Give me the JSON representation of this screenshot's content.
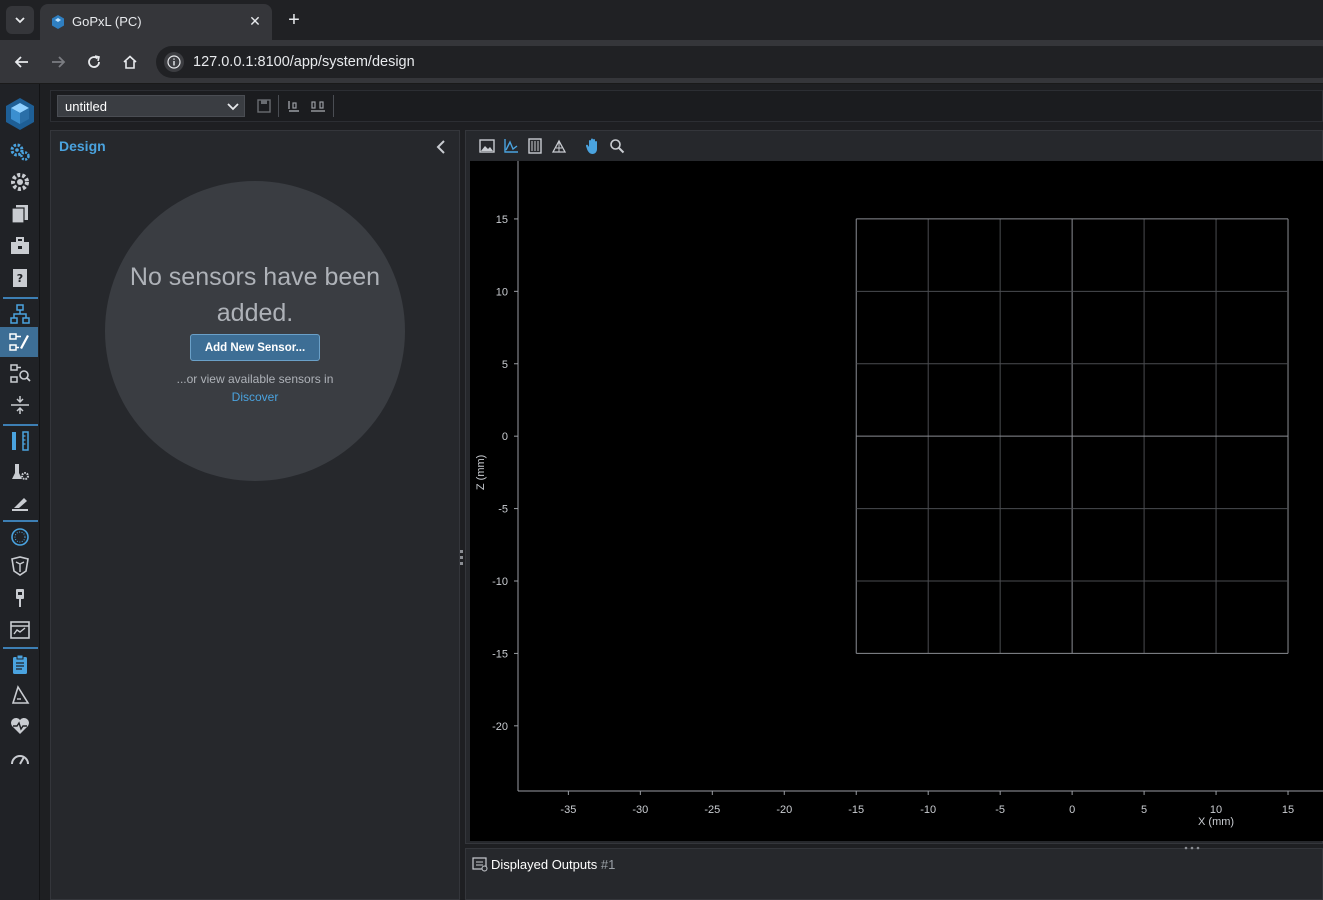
{
  "browser": {
    "tab_title": "GoPxL (PC)",
    "tab_close": "✕",
    "new_tab": "+",
    "url": "127.0.0.1:8100/app/system/design"
  },
  "app": {
    "job_name": "untitled",
    "panel_title": "Design",
    "empty_message": "No sensors have been added.",
    "add_sensor_label": "Add New Sensor...",
    "or_text": "...or view available sensors in",
    "discover_link": "Discover",
    "outputs_title": "Displayed Outputs",
    "outputs_number": "#1",
    "accent_color": "#4aa3df",
    "active_color": "#3d6e95"
  },
  "sidebar": {
    "items": [
      {
        "icon": "gears-icon"
      },
      {
        "icon": "gear-icon"
      },
      {
        "icon": "files-icon"
      },
      {
        "icon": "toolbox-icon"
      },
      {
        "icon": "help-book-icon"
      },
      {
        "icon": "network-icon"
      },
      {
        "icon": "design-icon",
        "active": true
      },
      {
        "icon": "tools-search-icon"
      },
      {
        "icon": "align-icon"
      },
      {
        "icon": "measure-icon"
      },
      {
        "icon": "scanner-settings-icon"
      },
      {
        "icon": "laser-icon"
      },
      {
        "icon": "sphere-icon"
      },
      {
        "icon": "filter-icon"
      },
      {
        "icon": "probe-icon"
      },
      {
        "icon": "dashboard-window-icon"
      },
      {
        "icon": "clipboard-icon"
      },
      {
        "icon": "triangle-measure-icon"
      },
      {
        "icon": "health-icon"
      },
      {
        "icon": "speedometer-icon"
      }
    ]
  },
  "chart_data": {
    "type": "scatter",
    "title": "",
    "xlabel": "X (mm)",
    "ylabel": "Z (mm)",
    "xlim": [
      -38.5,
      17.5
    ],
    "ylim": [
      -24.5,
      19
    ],
    "xticks": [
      -35,
      -30,
      -25,
      -20,
      -15,
      -10,
      -5,
      0,
      5,
      10,
      15
    ],
    "yticks": [
      15,
      10,
      5,
      0,
      -5,
      -10,
      -15,
      -20
    ],
    "field_of_view": {
      "x": [
        -15,
        15
      ],
      "z": [
        -15,
        15
      ],
      "grid_step_x": 5,
      "grid_step_z": 5
    },
    "series": []
  }
}
